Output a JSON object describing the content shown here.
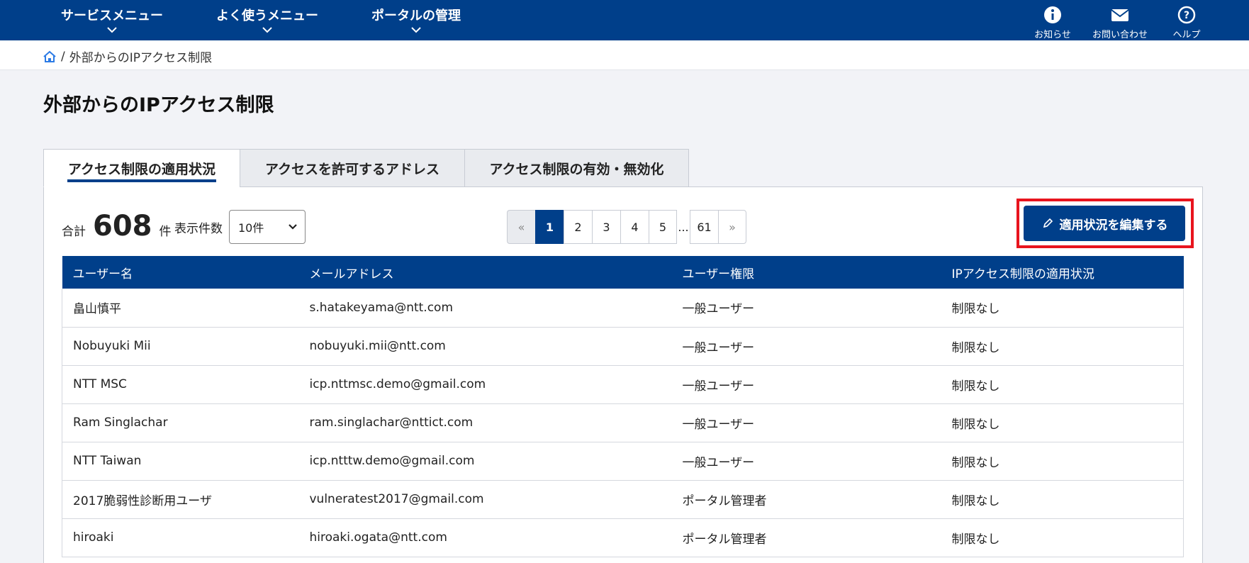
{
  "topbar": {
    "nav": [
      {
        "label": "サービスメニュー"
      },
      {
        "label": "よく使うメニュー"
      },
      {
        "label": "ポータルの管理"
      }
    ],
    "right": [
      {
        "label": "お知らせ",
        "icon": "info-icon"
      },
      {
        "label": "お問い合わせ",
        "icon": "mail-icon"
      },
      {
        "label": "ヘルプ",
        "icon": "help-icon"
      }
    ]
  },
  "breadcrumb": {
    "separator": "/",
    "current": "外部からのIPアクセス制限"
  },
  "page": {
    "title": "外部からのIPアクセス制限"
  },
  "tabs": [
    {
      "label": "アクセス制限の適用状況",
      "active": true
    },
    {
      "label": "アクセスを許可するアドレス",
      "active": false
    },
    {
      "label": "アクセス制限の有効・無効化",
      "active": false
    }
  ],
  "summary": {
    "total_label": "合計",
    "total_count": "608",
    "total_unit": "件",
    "per_page_label": "表示件数",
    "per_page_value": "10件"
  },
  "pagination": {
    "first": "«",
    "pages": [
      "1",
      "2",
      "3",
      "4",
      "5"
    ],
    "ellipsis": "...",
    "last_page": "61",
    "last": "»",
    "current": "1"
  },
  "edit_button": {
    "label": "適用状況を編集する"
  },
  "table": {
    "headers": [
      "ユーザー名",
      "メールアドレス",
      "ユーザー権限",
      "IPアクセス制限の適用状況"
    ],
    "rows": [
      [
        "畠山慎平",
        "s.hatakeyama@ntt.com",
        "一般ユーザー",
        "制限なし"
      ],
      [
        "Nobuyuki Mii",
        "nobuyuki.mii@ntt.com",
        "一般ユーザー",
        "制限なし"
      ],
      [
        "NTT MSC",
        "icp.nttmsc.demo@gmail.com",
        "一般ユーザー",
        "制限なし"
      ],
      [
        "Ram Singlachar",
        "ram.singlachar@nttict.com",
        "一般ユーザー",
        "制限なし"
      ],
      [
        "NTT Taiwan",
        "icp.ntttw.demo@gmail.com",
        "一般ユーザー",
        "制限なし"
      ],
      [
        "2017脆弱性診断用ユーザ",
        "vulneratest2017@gmail.com",
        "ポータル管理者",
        "制限なし"
      ],
      [
        "hiroaki",
        "hiroaki.ogata@ntt.com",
        "ポータル管理者",
        "制限なし"
      ]
    ]
  }
}
